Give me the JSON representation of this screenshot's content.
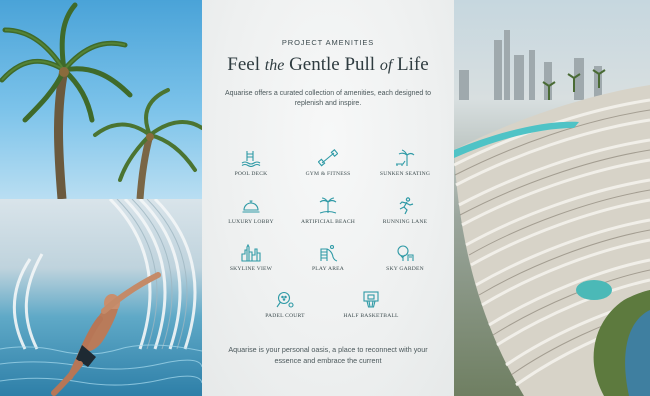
{
  "center": {
    "eyebrow": "PROJECT AMENITIES",
    "headline_part1": "Feel ",
    "headline_italic1": "the",
    "headline_part2": " Gentle Pull ",
    "headline_italic2": "of",
    "headline_part3": " Life",
    "intro": "Aquarise offers a curated collection of amenities, each designed to replenish and inspire.",
    "outro": "Aquarise is your personal oasis, a place to reconnect with your essence and embrace the current"
  },
  "amenities": [
    {
      "label": "POOL DECK",
      "icon": "pool-ladder-icon"
    },
    {
      "label": "GYM & FITNESS",
      "icon": "dumbbell-icon"
    },
    {
      "label": "SUNKEN SEATING",
      "icon": "palm-lounger-icon"
    },
    {
      "label": "LUXURY LOBBY",
      "icon": "service-bell-icon"
    },
    {
      "label": "ARTIFICIAL BEACH",
      "icon": "palm-umbrella-icon"
    },
    {
      "label": "RUNNING LANE",
      "icon": "runner-icon"
    },
    {
      "label": "SKYLINE VIEW",
      "icon": "skyline-icon"
    },
    {
      "label": "PLAY AREA",
      "icon": "slide-icon"
    },
    {
      "label": "SKY GARDEN",
      "icon": "tree-icon"
    },
    {
      "label": "PADEL COURT",
      "icon": "padel-racket-icon"
    },
    {
      "label": "HALF BASKETBALL",
      "icon": "basketball-hoop-icon"
    }
  ],
  "colors": {
    "icon_teal": "#2f9aa6",
    "text_dark": "#2f3c40",
    "panel_bg": "#eef0f0"
  }
}
